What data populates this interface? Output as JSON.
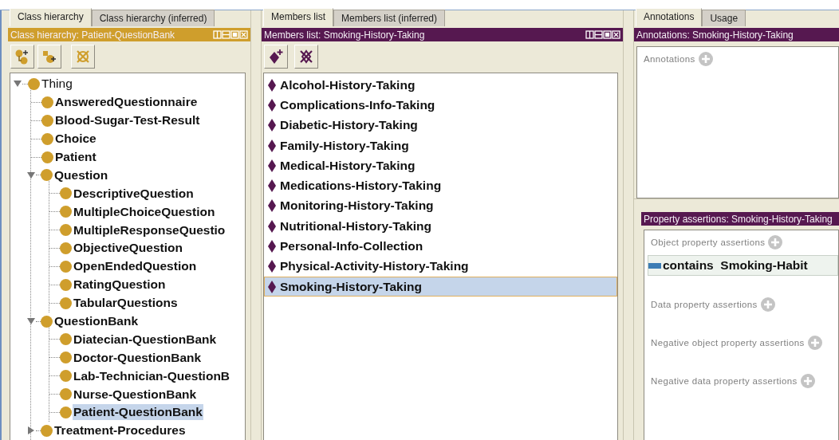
{
  "class_hierarchy_view": {
    "kind": "class",
    "tabs": [
      {
        "label": "Class hierarchy",
        "selected": true
      },
      {
        "label": "Class hierarchy (inferred)",
        "selected": false
      }
    ],
    "title": "Class hierarchy: Patient-QuestionBank",
    "window_buttons": true,
    "tree": [
      {
        "label": "Thing",
        "selected": false,
        "expanded": true,
        "children": [
          {
            "label": "AnsweredQuestionnaire",
            "selected": false
          },
          {
            "label": "Blood-Sugar-Test-Result",
            "selected": false
          },
          {
            "label": "Choice",
            "selected": false
          },
          {
            "label": "Patient",
            "selected": false
          },
          {
            "label": "Question",
            "selected": false,
            "expanded": true,
            "children": [
              {
                "label": "DescriptiveQuestion",
                "selected": false
              },
              {
                "label": "MultipleChoiceQuestion",
                "selected": false
              },
              {
                "label": "MultipleResponseQuestio",
                "selected": false
              },
              {
                "label": "ObjectiveQuestion",
                "selected": false
              },
              {
                "label": "OpenEndedQuestion",
                "selected": false
              },
              {
                "label": "RatingQuestion",
                "selected": false
              },
              {
                "label": "TabularQuestions",
                "selected": false
              }
            ]
          },
          {
            "label": "QuestionBank",
            "selected": false,
            "expanded": true,
            "children": [
              {
                "label": "Diatecian-QuestionBank",
                "selected": false
              },
              {
                "label": "Doctor-QuestionBank",
                "selected": false
              },
              {
                "label": "Lab-Technician-QuestionB",
                "selected": false
              },
              {
                "label": "Nurse-QuestionBank",
                "selected": false
              },
              {
                "label": "Patient-QuestionBank",
                "selected": true
              }
            ]
          },
          {
            "label": "Treatment-Procedures",
            "selected": false,
            "expanded": false
          }
        ]
      }
    ]
  },
  "members_view": {
    "kind": "individual",
    "tabs": [
      {
        "label": "Members list",
        "selected": true
      },
      {
        "label": "Members list (inferred)",
        "selected": false
      }
    ],
    "title": "Members list: Smoking-History-Taking",
    "window_buttons": true,
    "members": [
      {
        "label": "Alcohol-History-Taking",
        "selected": false
      },
      {
        "label": "Complications-Info-Taking",
        "selected": false
      },
      {
        "label": "Diabetic-History-Taking",
        "selected": false
      },
      {
        "label": "Family-History-Taking",
        "selected": false
      },
      {
        "label": "Medical-History-Taking",
        "selected": false
      },
      {
        "label": "Medications-History-Taking",
        "selected": false
      },
      {
        "label": "Monitoring-History-Taking",
        "selected": false
      },
      {
        "label": "Nutritional-History-Taking",
        "selected": false
      },
      {
        "label": "Personal-Info-Collection",
        "selected": false
      },
      {
        "label": "Physical-Activity-History-Taking",
        "selected": false
      },
      {
        "label": "Smoking-History-Taking",
        "selected": true
      }
    ]
  },
  "annotations_view": {
    "kind": "individual",
    "tabs": [
      {
        "label": "Annotations",
        "selected": true
      },
      {
        "label": "Usage",
        "selected": false
      }
    ],
    "title": "Annotations: Smoking-History-Taking",
    "sections": [
      {
        "label": "Annotations"
      }
    ]
  },
  "property_assertions_view": {
    "kind": "individual",
    "title": "Property assertions: Smoking-History-Taking",
    "sections": [
      {
        "label": "Object property assertions",
        "assertions": [
          {
            "property": "contains",
            "value": "Smoking-Habit"
          }
        ]
      },
      {
        "label": "Data property assertions"
      },
      {
        "label": "Negative object property assertions"
      },
      {
        "label": "Negative data property assertions"
      }
    ]
  }
}
